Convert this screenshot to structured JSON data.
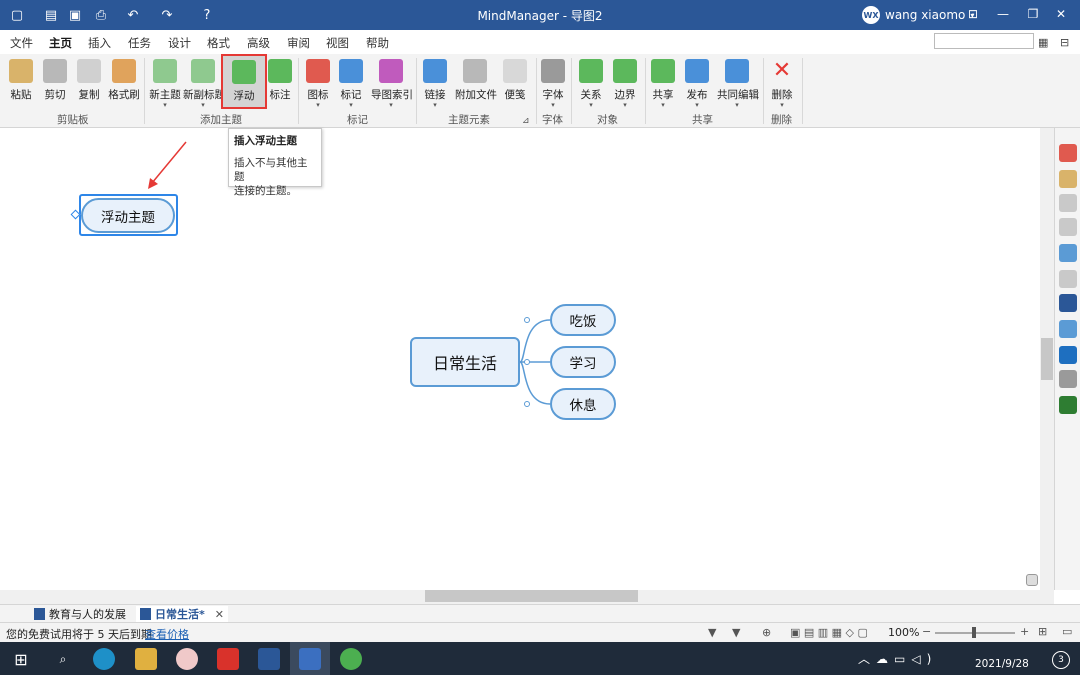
{
  "app": {
    "title": "MindManager - 导图2"
  },
  "user": {
    "initials": "WX",
    "name": "wang xiaomo"
  },
  "menu_tabs": [
    "文件",
    "主页",
    "插入",
    "任务",
    "设计",
    "格式",
    "高级",
    "审阅",
    "视图",
    "帮助"
  ],
  "active_tab": "主页",
  "ribbon": {
    "buttons": {
      "paste": "粘贴",
      "cut": "剪切",
      "copy": "复制",
      "format_painter": "格式刷",
      "new_topic": "新主题",
      "new_subtopic": "新副标题",
      "floating": "浮动",
      "callout": "标注",
      "icon": "图标",
      "tag": "标记",
      "map_index": "导图索引",
      "link": "链接",
      "attach": "附加文件",
      "note": "便笺",
      "font": "字体",
      "relation": "关系",
      "boundary": "边界",
      "share": "共享",
      "publish": "发布",
      "co_edit": "共同编辑",
      "delete": "删除"
    },
    "groups": {
      "clipboard": "剪贴板",
      "add_topic": "添加主题",
      "markers": "标记",
      "topic_elements": "主题元素",
      "font": "字体",
      "objects": "对象",
      "share": "共享",
      "delete": "删除"
    }
  },
  "tooltip": {
    "title": "插入浮动主题",
    "line1": "插入不与其他主题",
    "line2": "连接的主题。"
  },
  "map": {
    "central_topic": "日常生活",
    "subtopics": [
      "吃饭",
      "学习",
      "休息"
    ],
    "floating_topic": "浮动主题"
  },
  "doc_tabs": [
    {
      "label": "教育与人的发展",
      "active": false
    },
    {
      "label": "日常生活*",
      "active": true
    }
  ],
  "status": {
    "trial_text": "您的免费试用将于 5 天后到期",
    "pricing_link": "查看价格",
    "zoom": "100%"
  },
  "taskbar": {
    "date": "2021/9/28"
  },
  "colors": {
    "titlebar": "#2b5797",
    "topic_fill": "#e8f1fb",
    "topic_border": "#5b9bd5",
    "selection": "#2e86e8",
    "highlight": "#e53935",
    "arrow": "#e53935"
  }
}
